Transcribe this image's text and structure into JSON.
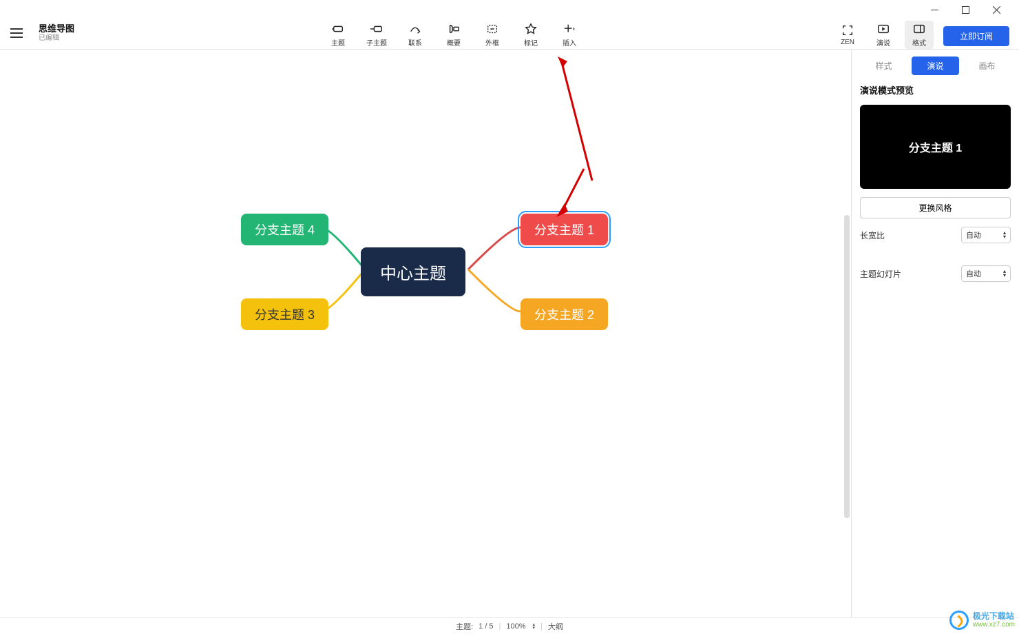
{
  "window": {
    "title": "思维导图",
    "subtitle": "已编辑"
  },
  "toolbar": {
    "items": [
      {
        "id": "topic",
        "label": "主题"
      },
      {
        "id": "subtopic",
        "label": "子主题"
      },
      {
        "id": "relation",
        "label": "联系"
      },
      {
        "id": "summary",
        "label": "概要"
      },
      {
        "id": "boundary",
        "label": "外框"
      },
      {
        "id": "marker",
        "label": "标记"
      },
      {
        "id": "insert",
        "label": "插入"
      }
    ],
    "right": [
      {
        "id": "zen",
        "label": "ZEN"
      },
      {
        "id": "present",
        "label": "演说"
      },
      {
        "id": "format",
        "label": "格式",
        "active": true
      }
    ],
    "subscribe": "立即订阅"
  },
  "mindmap": {
    "center": "中心主题",
    "branches": [
      {
        "id": 1,
        "label": "分支主题 1",
        "color": "red",
        "selected": true
      },
      {
        "id": 2,
        "label": "分支主题 2",
        "color": "orange"
      },
      {
        "id": 3,
        "label": "分支主题 3",
        "color": "yellow"
      },
      {
        "id": 4,
        "label": "分支主题 4",
        "color": "green"
      }
    ]
  },
  "sidebar": {
    "tabs": [
      {
        "id": "style",
        "label": "样式"
      },
      {
        "id": "present",
        "label": "演说",
        "active": true
      },
      {
        "id": "canvas",
        "label": "画布"
      }
    ],
    "preview_label": "演说模式预览",
    "preview_text": "分支主题 1",
    "change_style": "更换风格",
    "aspect_label": "长宽比",
    "aspect_value": "自动",
    "slide_label": "主题幻灯片",
    "slide_value": "自动"
  },
  "statusbar": {
    "topic_label": "主题:",
    "topic_value": "1 / 5",
    "zoom": "100%",
    "outline": "大纲"
  },
  "watermark": {
    "line1": "极光下载站",
    "line2": "www.xz7.com"
  }
}
